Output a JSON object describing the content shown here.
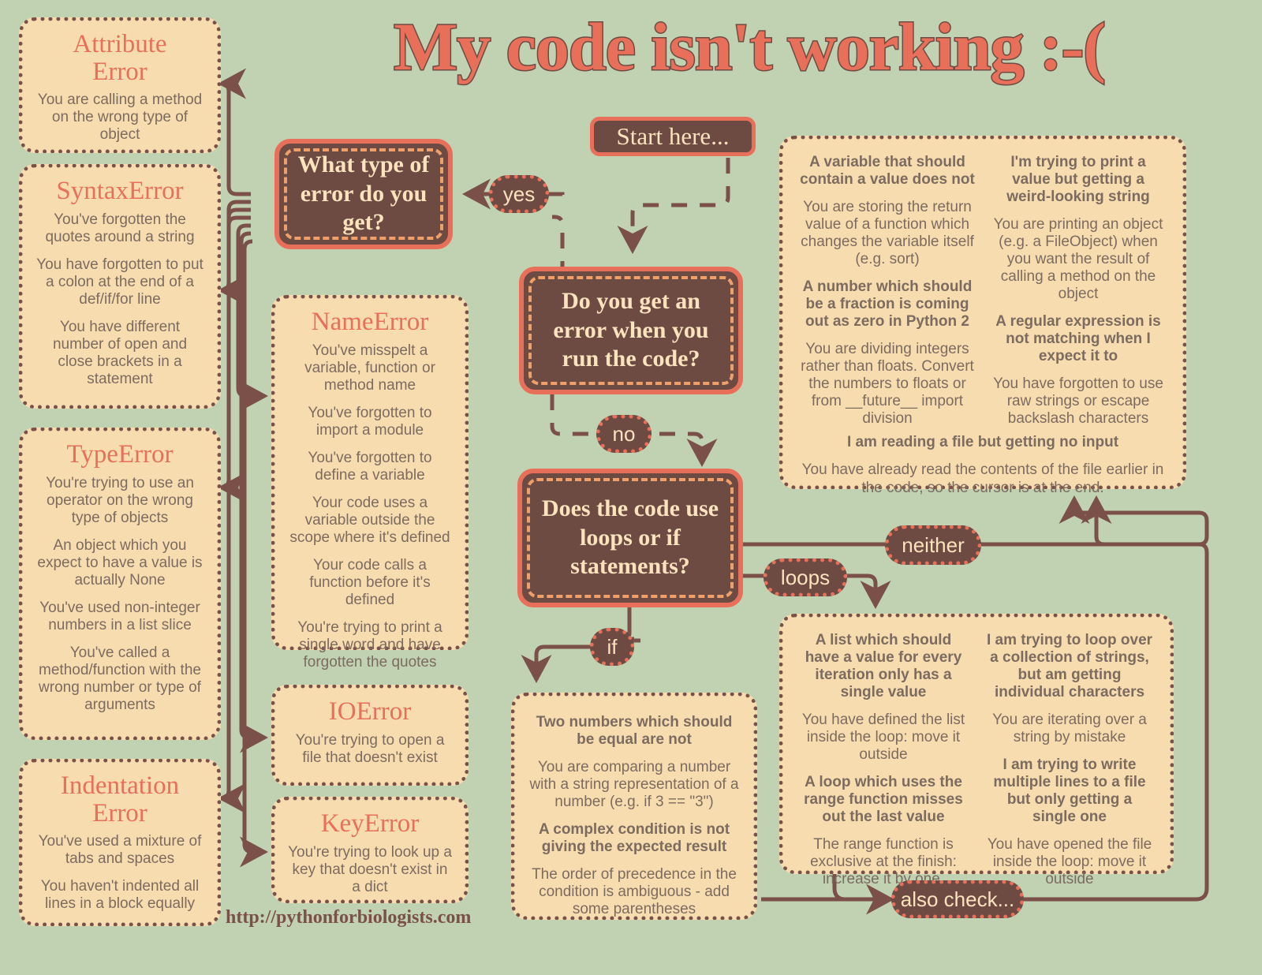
{
  "title": "My code isn't working :-(",
  "site_url": "http://pythonforbiologists.com",
  "colors": {
    "background": "#c0d2b1",
    "card_fill": "#f7dcb0",
    "card_border": "#7a5048",
    "accent": "#e8705a",
    "dark": "#6d4b43",
    "cream_text": "#fae3bd",
    "body_text": "#7c6b5f",
    "inner_dash": "#efa06a"
  },
  "nodes": {
    "start": "Start here...",
    "q_error": "Do you get an error when you run the code?",
    "q_error_type": "What type of error  do you get?",
    "q_loops": "Does the code use loops or if statements?"
  },
  "edge_labels": {
    "yes": "yes",
    "no": "no",
    "loops": "loops",
    "if": "if",
    "neither": "neither",
    "also_check": "also check..."
  },
  "errors": [
    {
      "name": "attribute_error",
      "title": "Attribute\nError",
      "causes": [
        "You are calling a method on the wrong type of object"
      ]
    },
    {
      "name": "syntax_error",
      "title": "SyntaxError",
      "causes": [
        "You've forgotten the quotes around a string",
        "You have forgotten to put a colon at the end of a def/if/for line",
        "You have different number of open and close brackets in a statement"
      ]
    },
    {
      "name": "type_error",
      "title": "TypeError",
      "causes": [
        "You're trying to use an operator on the wrong type of objects",
        "An object which you expect to have a value is actually None",
        "You've used non-integer numbers in a list slice",
        "You've called a method/function with the wrong number or type of arguments"
      ]
    },
    {
      "name": "indentation_error",
      "title": "Indentation\nError",
      "causes": [
        "You've used a mixture of tabs and spaces",
        "You haven't indented all lines in a block equally"
      ]
    },
    {
      "name": "name_error",
      "title": "NameError",
      "causes": [
        "You've misspelt a variable, function or method name",
        "You've forgotten to import a module",
        "You've forgotten to define a variable",
        "Your code uses a variable outside the scope where it's defined",
        "Your code calls a function before it's defined",
        "You're trying to print a single word and have forgotten the quotes"
      ]
    },
    {
      "name": "io_error",
      "title": "IOError",
      "causes": [
        "You're trying to open a file that doesn't exist"
      ]
    },
    {
      "name": "key_error",
      "title": "KeyError",
      "causes": [
        "You're trying to look up a key that doesn't exist in a dict"
      ]
    }
  ],
  "no_error_panel": {
    "left_column": [
      {
        "heading": "A variable that should contain a value does not",
        "body": "You are storing the return value of a function which changes the variable itself (e.g. sort)"
      },
      {
        "heading": "A number which should be a fraction is coming out as zero in Python 2",
        "body": "You are dividing integers rather than floats. Convert the numbers to floats or from __future__ import division"
      }
    ],
    "right_column": [
      {
        "heading": "I'm trying to print a value but getting a weird-looking string",
        "body": "You are printing an object (e.g. a FileObject) when you want the result of calling a method on the object"
      },
      {
        "heading": "A regular expression is not matching when I expect it to",
        "body": "You have forgotten to use raw strings or escape backslash characters"
      }
    ],
    "footer": {
      "heading": "I am reading a file but getting no input",
      "body": "You have already read the contents of the file earlier in the code, so the cursor is at the end."
    }
  },
  "if_panel": [
    {
      "heading": "Two numbers which should be equal are not",
      "body": "You are comparing a number with a string representation of a number (e.g. if 3 == \"3\")"
    },
    {
      "heading": "A complex condition is not giving the expected result",
      "body": "The order of precedence in the condition is ambiguous - add some parentheses"
    }
  ],
  "loops_panel": {
    "left_column": [
      {
        "heading": "A list which should have a value for every iteration only has a single value",
        "body": "You have defined the list inside the loop: move it outside"
      },
      {
        "heading": "A loop which uses the range function misses out the last value",
        "body": "The range function is exclusive at the finish: increase it by one."
      }
    ],
    "right_column": [
      {
        "heading": "I am trying to loop over a collection of strings, but am getting individual characters",
        "body": "You are iterating over a string by mistake"
      },
      {
        "heading": "I am trying to write multiple lines to a file but only getting a single one",
        "body": "You have opened the file inside the loop: move it outside"
      }
    ]
  }
}
